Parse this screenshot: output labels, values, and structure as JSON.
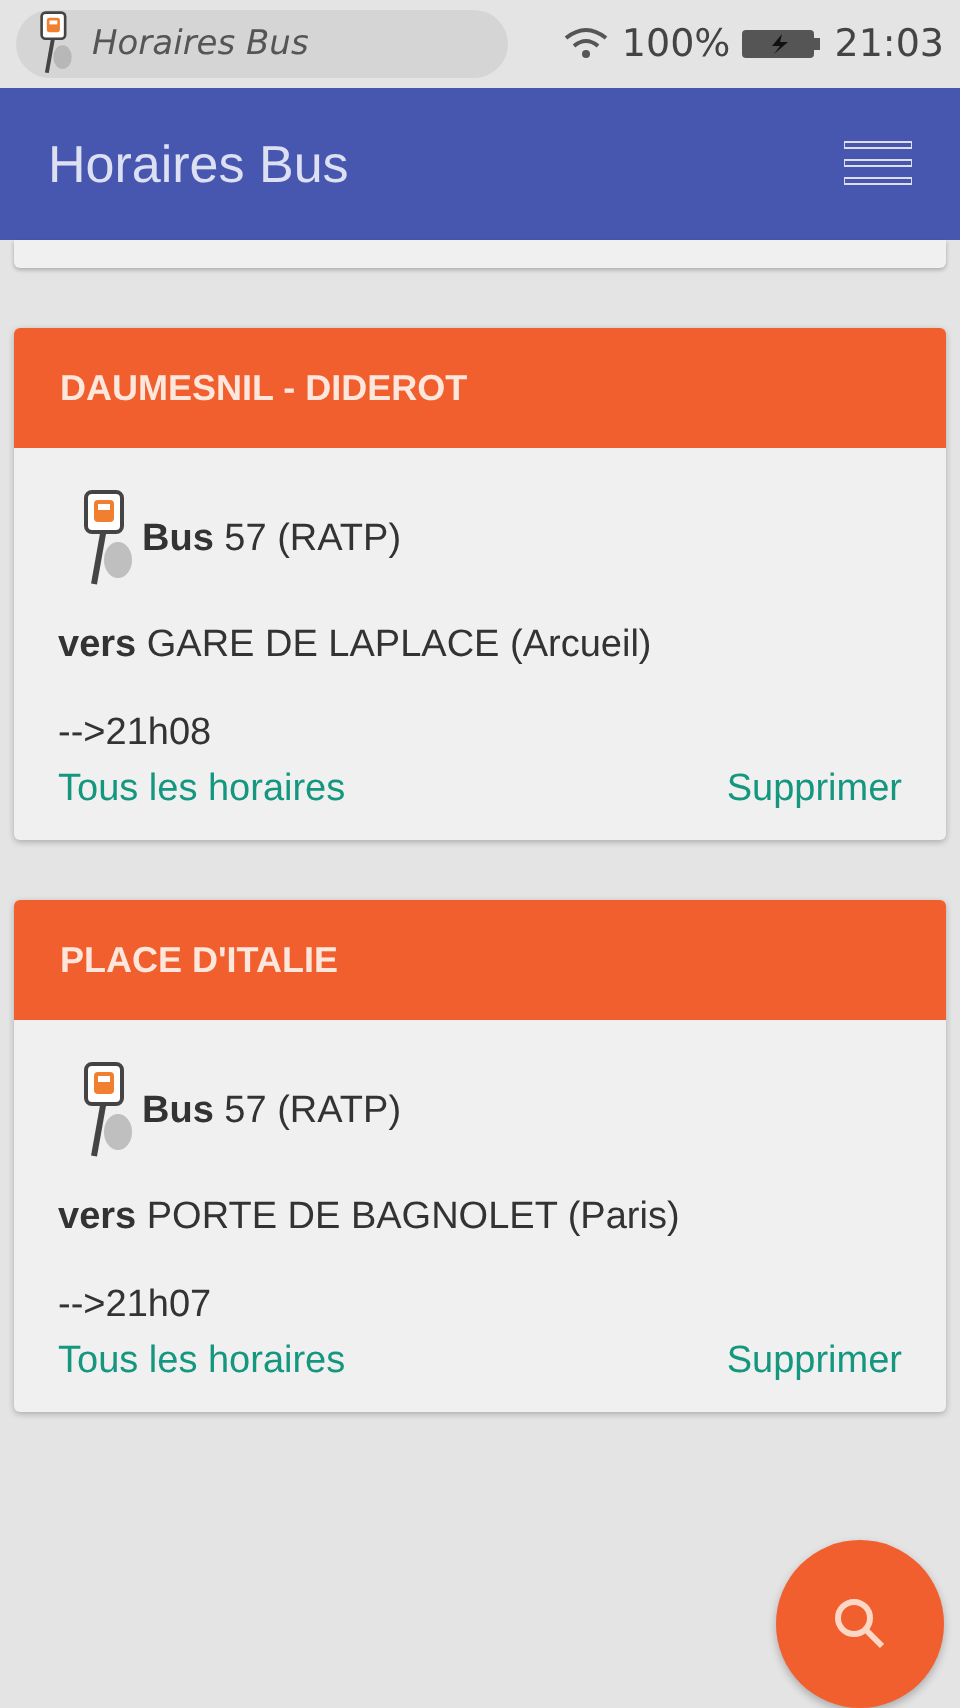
{
  "status_bar": {
    "app_title": "Horaires Bus",
    "battery": "100%",
    "time": "21:03"
  },
  "app_bar": {
    "title": "Horaires Bus"
  },
  "cards": [
    {
      "stop": "DAUMESNIL - DIDEROT",
      "line": "**Bus** 57 (RATP)",
      "direction": "**vers** GARE DE LAPLACE (Arcueil)",
      "next": "-->21h08",
      "all_link": "Tous les horaires",
      "delete_link": "Supprimer"
    },
    {
      "stop": "PLACE D'ITALIE",
      "line": "**Bus** 57 (RATP)",
      "direction": "**vers** PORTE DE BAGNOLET (Paris)",
      "next": "-->21h07",
      "all_link": "Tous les horaires",
      "delete_link": "Supprimer"
    }
  ]
}
